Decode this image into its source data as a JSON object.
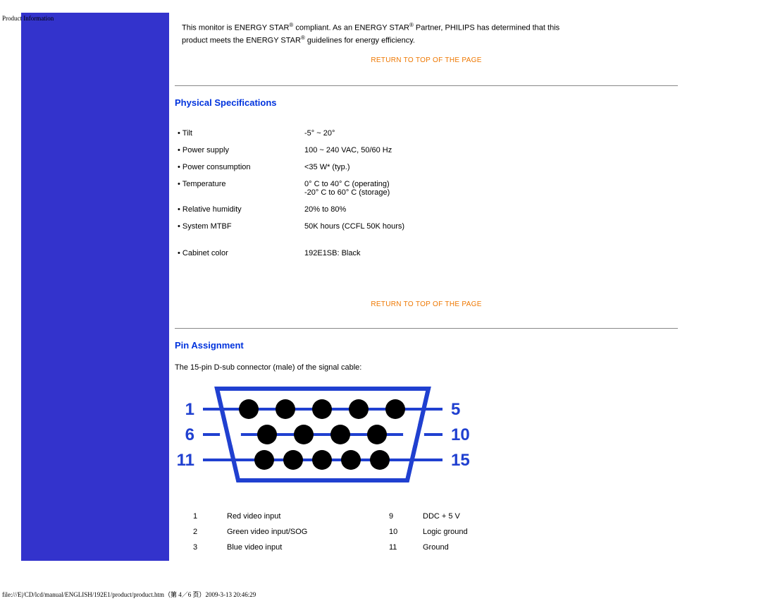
{
  "header": "Product Information",
  "footer": "file:///E|/CD/lcd/manual/ENGLISH/192E1/product/product.htm（第 4／6 页）2009-3-13 20:46:29",
  "intro_l1_pre": "This monitor is ENERGY STAR",
  "intro_l1_mid": " compliant. As an ENERGY STAR",
  "intro_l1_post": " Partner, PHILIPS has determined that this",
  "intro_l2_pre": "product meets the ENERGY STAR",
  "intro_l2_post": " guidelines for energy efficiency.",
  "return_label": "RETURN TO TOP OF THE PAGE",
  "phys_title": "Physical Specifications",
  "specs": {
    "tilt_l": "Tilt",
    "tilt_v": "-5° ~ 20°",
    "psu_l": "Power supply",
    "psu_v": "100 ~ 240 VAC, 50/60 Hz",
    "pc_l": "Power consumption",
    "pc_v": "<35 W* (typ.)",
    "temp_l": "Temperature",
    "temp_v1": "0° C to 40° C (operating)",
    "temp_v2": "-20° C to 60° C (storage)",
    "rh_l": "Relative humidity",
    "rh_v": "20% to 80%",
    "mtbf_l": "System MTBF",
    "mtbf_v": "50K hours (CCFL 50K hours)",
    "cab_l": "Cabinet color",
    "cab_v": "192E1SB: Black"
  },
  "pin_title": "Pin Assignment",
  "pin_desc": "The 15-pin D-sub connector (male) of the signal cable:",
  "conn_labels": {
    "l1": "1",
    "l6": "6",
    "l11": "11",
    "r5": "5",
    "r10": "10",
    "r15": "15"
  },
  "pins": {
    "p1n": "1",
    "p1l": "Red video input",
    "p9n": "9",
    "p9l": "DDC + 5 V",
    "p2n": "2",
    "p2l": "Green video input/SOG",
    "p10n": "10",
    "p10l": "Logic ground",
    "p3n": "3",
    "p3l": "Blue video input",
    "p11n": "11",
    "p11l": "Ground"
  }
}
